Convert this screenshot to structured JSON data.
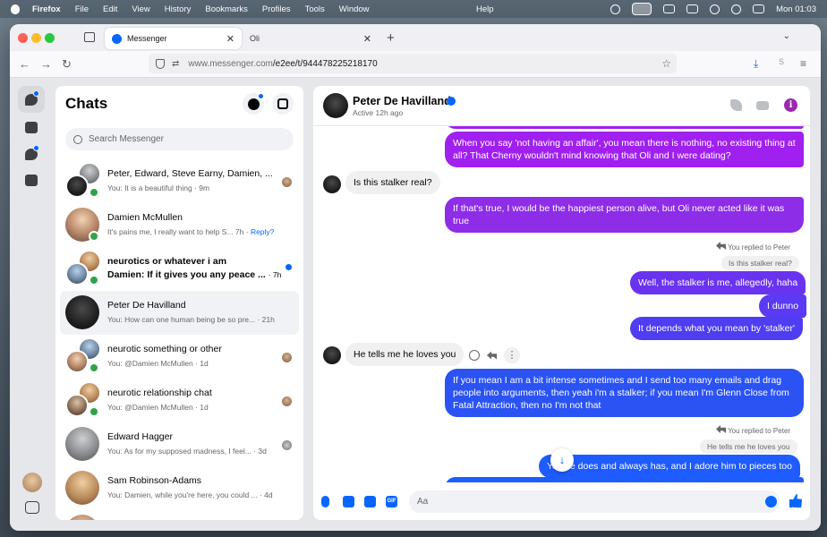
{
  "menubar": {
    "app": "Firefox",
    "items": [
      "File",
      "Edit",
      "View",
      "History",
      "Bookmarks",
      "Profiles",
      "Tools",
      "Window"
    ],
    "help": "Help",
    "clock": "Mon 01:03"
  },
  "browser": {
    "tabs": [
      {
        "title": "Messenger",
        "active": true
      },
      {
        "title": "Oli",
        "active": false
      }
    ],
    "url_host": "www.messenger.com",
    "url_path": "/e2ee/t/944478225218170"
  },
  "chats": {
    "title": "Chats",
    "search_placeholder": "Search Messenger",
    "items": [
      {
        "name": "Peter, Edward, Steve Earny, Damien, ...",
        "preview": "You: It is a beautiful thing · 9m",
        "group": true
      },
      {
        "name": "Damien McMullen",
        "preview": "It's pains me, I really want to help S...",
        "time": "7h ·",
        "reply": "Reply?"
      },
      {
        "name": "neurotics or whatever i am",
        "preview": "Damien: If it gives you any peace ...",
        "time": "· 7h",
        "unread": true
      },
      {
        "name": "Peter De Havilland",
        "preview": "You: How can one human being be so pre... · 21h",
        "selected": true
      },
      {
        "name": "neurotic something or other",
        "preview": "You: @Damien McMullen · 1d",
        "group": true
      },
      {
        "name": "neurotic relationship chat",
        "preview": "You: @Damien McMullen · 1d",
        "group": true
      },
      {
        "name": "Edward Hagger",
        "preview": "You: As for my supposed madness, I feel... · 3d"
      },
      {
        "name": "Sam Robinson-Adams",
        "preview": "You: Damien, while you're here, you could ... · 4d"
      }
    ]
  },
  "conversation": {
    "name": "Peter De Havilland",
    "status": "Active 12h ago",
    "info_glyph": "i",
    "messages": {
      "m1": "When you say 'not having an affair', you mean there is nothing, no existing thing at all? That Cherny wouldn't mind knowing that Oli and I were dating?",
      "m2": "Is this stalker real?",
      "m3": "If that's true, I would be the happiest person alive, but Oli never acted like it was true",
      "reply_meta_1": "You replied to Peter",
      "quoted_1": "Is this stalker real?",
      "m4": "Well, the stalker is me, allegedly, haha",
      "m5": "I dunno",
      "m6": "It depends what you mean by 'stalker'",
      "m7": "He tells me he loves you",
      "m8": "If you mean I am a bit intense sometimes and I send too many emails and drag people into arguments, then yeah i'm a stalker; if you mean I'm Glenn Close from Fatal Attraction, then no I'm not that",
      "reply_meta_2": "You replied to Peter",
      "quoted_2": "He tells me he loves you",
      "m9": "Yes he does and always has, and I adore him to pieces too"
    },
    "composer_placeholder": "Aa",
    "gif_label": "GIF"
  },
  "colors": {
    "accent": "#0866ff",
    "bubble_purple": "#a020f0",
    "bubble_blue": "#1e5cff",
    "online": "#31a24c"
  }
}
